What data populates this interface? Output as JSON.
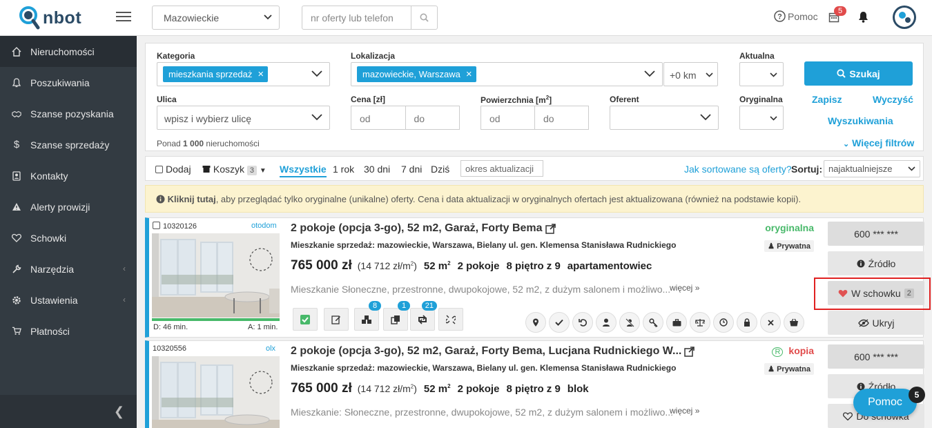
{
  "header": {
    "logo_text": "nbot",
    "region_value": "Mazowieckie",
    "search_placeholder": "nr oferty lub telefon",
    "help_label": "Pomoc",
    "calendar_badge": "5"
  },
  "sidebar": {
    "items": [
      {
        "label": "Nieruchomości",
        "icon": "home-icon"
      },
      {
        "label": "Poszukiwania",
        "icon": "bell-outline-icon"
      },
      {
        "label": "Szanse pozyskania",
        "icon": "handshake-icon"
      },
      {
        "label": "Szanse sprzedaży",
        "icon": "dollar-icon"
      },
      {
        "label": "Kontakty",
        "icon": "contacts-icon"
      },
      {
        "label": "Alerty prowizji",
        "icon": "warning-icon"
      },
      {
        "label": "Schowki",
        "icon": "heart-outline-icon"
      },
      {
        "label": "Narzędzia",
        "icon": "wrench-icon"
      },
      {
        "label": "Ustawienia",
        "icon": "gear-icon"
      },
      {
        "label": "Płatności",
        "icon": "cart-icon"
      }
    ]
  },
  "filters": {
    "kategoria_label": "Kategoria",
    "kategoria_chip": "mieszkania sprzedaż",
    "lokalizacja_label": "Lokalizacja",
    "lokalizacja_chip": "mazowieckie, Warszawa",
    "radius_value": "+0 km",
    "aktualna_label": "Aktualna",
    "search_button": "Szukaj",
    "ulica_label": "Ulica",
    "ulica_placeholder": "wpisz i wybierz ulicę",
    "cena_label": "Cena [zł]",
    "cena_od": "od",
    "cena_do": "do",
    "powierzchnia_label": "Powierzchnia [m",
    "powierzchnia_sup": "2",
    "powierzchnia_end": "]",
    "pow_od": "od",
    "pow_do": "do",
    "oferent_label": "Oferent",
    "oryginalna_label": "Oryginalna",
    "zapisz": "Zapisz",
    "wyczysc": "Wyczyść",
    "wyszukiwania": "Wyszukiwania",
    "count_prefix": "Ponad ",
    "count_value": "1 000",
    "count_suffix": " nieruchomości",
    "more_filters": "Więcej filtrów"
  },
  "toolbar": {
    "dodaj": "Dodaj",
    "koszyk": "Koszyk",
    "koszyk_count": "3",
    "tabs": [
      "Wszystkie",
      "1 rok",
      "30 dni",
      "7 dni",
      "Dziś"
    ],
    "update_period": "okres aktualizacji",
    "sort_question": "Jak sortowane są oferty?",
    "sort_label": "Sortuj:",
    "sort_value": "najaktualniejsze"
  },
  "banner": {
    "bold": "Kliknij tutaj",
    "text": ", aby przeglądać tylko oryginalne (unikalne) oferty. Cena i data aktualizacji w oryginalnych ofertach jest aktualizowana (również na podstawie kopii)."
  },
  "listings": [
    {
      "id": "10320126",
      "source": "otodom",
      "title": "2 pokoje (opcja 3-go), 52 m2, Garaż, Forty Bema",
      "address": "Mieszkanie sprzedaż: mazowieckie, Warszawa, Bielany ul. gen. Klemensa Stanisława Rudnickiego",
      "price": "765 000 zł",
      "per_m2": "(14 712 zł/m",
      "per_m2_end": ")",
      "area": "52 m",
      "rooms": "2 pokoje",
      "floor": "8 piętro z 9",
      "building": "apartamentowiec",
      "description": "Mieszkanie Słoneczne, przestronne, dwupokojowe, 52 m2, z dużym salonem i możliwo...",
      "more": "więcej",
      "status": "oryginalna",
      "status_color": "#48b96a",
      "owner_type": "Prywatna",
      "time_left": "D: 46 min.",
      "time_right": "A: 1 min.",
      "badge_agencies": "8",
      "badge_copies": "1",
      "badge_refresh": "21",
      "phone": "600 *** ***",
      "source_btn": "Źródło",
      "clipboard_btn": "W schowku",
      "clipboard_count": "2",
      "hide_btn": "Ukryj"
    },
    {
      "id": "10320556",
      "source": "olx",
      "title": "2 pokoje (opcja 3-go), 52 m2, Garaż, Forty Bema, Lucjana Rudnickiego W...",
      "address": "Mieszkanie sprzedaż: mazowieckie, Warszawa, Bielany ul. gen. Klemensa Stanisława Rudnickiego",
      "price": "765 000 zł",
      "per_m2": "(14 712 zł/m",
      "per_m2_end": ")",
      "area": "52 m",
      "rooms": "2 pokoje",
      "floor": "8 piętro z 9",
      "building": "blok",
      "description": "Mieszkanie: Słoneczne, przestronne, dwupokojowe, 52 m2, z dużym salonem i możliwo...",
      "more": "więcej",
      "status": "kopia",
      "status_color": "#e14b4b",
      "owner_type": "Prywatna",
      "phone": "600 *** ***",
      "source_btn": "Źródło",
      "clipboard_btn": "Do schowka"
    }
  ],
  "help_float": {
    "label": "Pomoc",
    "count": "5"
  }
}
